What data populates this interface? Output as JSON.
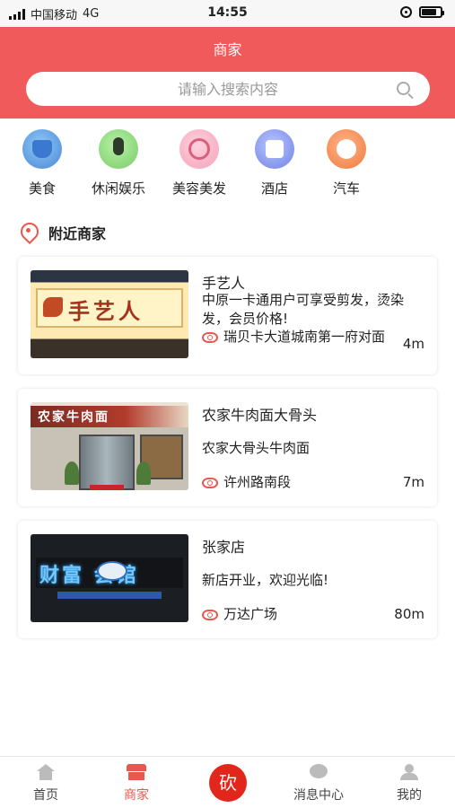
{
  "status_bar": {
    "carrier": "中国移动",
    "network": "4G",
    "time": "14:55"
  },
  "header": {
    "title": "商家"
  },
  "search": {
    "placeholder": "请输入搜索内容",
    "value": ""
  },
  "categories": [
    {
      "label": "美食",
      "icon": "food-icon",
      "color": "#4a86d8"
    },
    {
      "label": "休闲娱乐",
      "icon": "microphone-icon",
      "color": "#79cc66"
    },
    {
      "label": "美容美发",
      "icon": "beauty-icon",
      "color": "#f3a1b8"
    },
    {
      "label": "酒店",
      "icon": "hotel-icon",
      "color": "#6f82e4"
    },
    {
      "label": "汽车",
      "icon": "car-wheel-icon",
      "color": "#f07a3d"
    }
  ],
  "nearby": {
    "title": "附近商家"
  },
  "merchants": [
    {
      "name": "手艺人",
      "description": "中原一卡通用户可享受剪发，烫染发，会员价格!",
      "location": "瑞贝卡大道城南第一府对面",
      "distance": "4m",
      "image_sign": "手艺人"
    },
    {
      "name": "农家牛肉面大骨头",
      "description": "农家大骨头牛肉面",
      "location": "许州路南段",
      "distance": "7m",
      "image_sign": "农家牛肉面"
    },
    {
      "name": "张家店",
      "description": "新店开业，欢迎光临!",
      "location": "万达广场",
      "distance": "80m",
      "image_sign": "财富  会馆"
    }
  ],
  "tabbar": {
    "items": [
      {
        "label": "首页",
        "icon": "home-icon",
        "active": false
      },
      {
        "label": "商家",
        "icon": "shop-icon",
        "active": true
      },
      {
        "label": "砍",
        "icon": "bargain-button",
        "active": false
      },
      {
        "label": "消息中心",
        "icon": "chat-icon",
        "active": false
      },
      {
        "label": "我的",
        "icon": "user-icon",
        "active": false
      }
    ]
  },
  "colors": {
    "brand": "#f05a5a",
    "accent": "#e8584e",
    "bargain": "#e3261c"
  }
}
